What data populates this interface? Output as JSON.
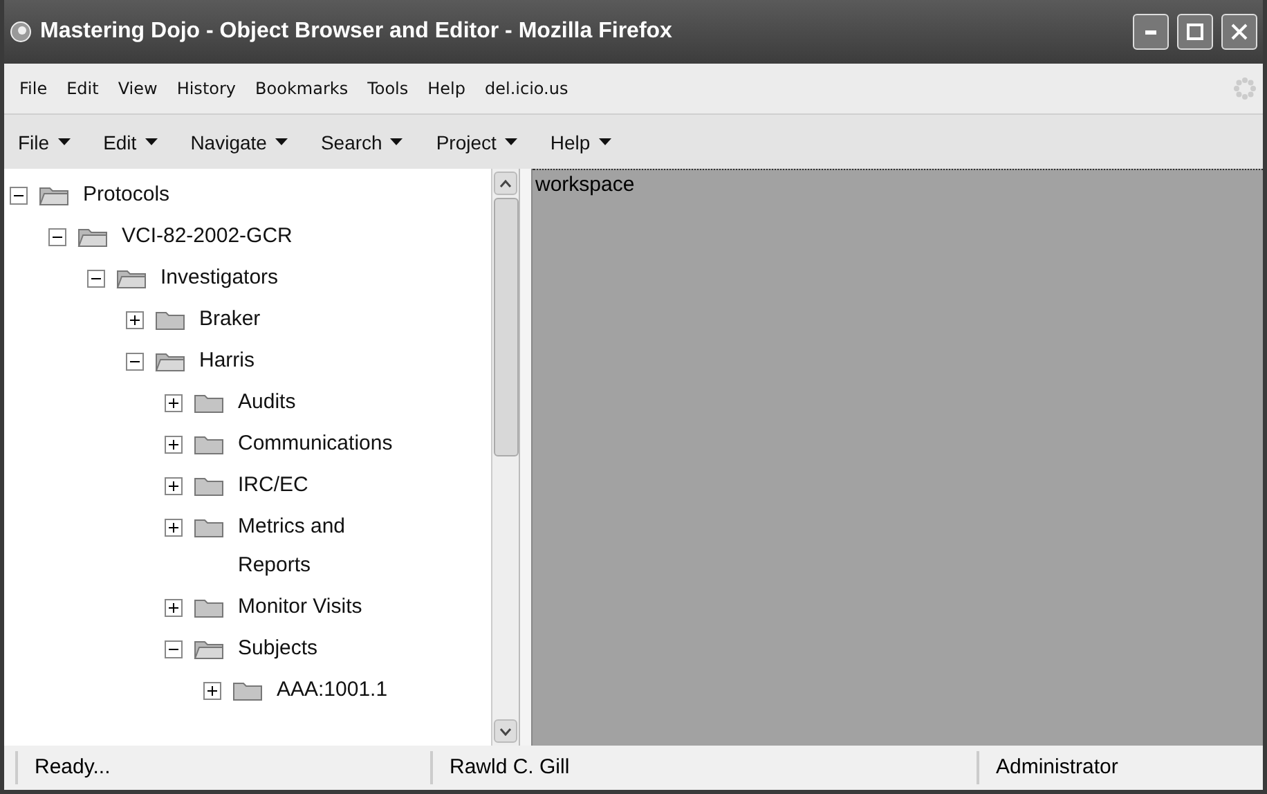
{
  "window": {
    "title": "Mastering Dojo - Object Browser and Editor - Mozilla Firefox"
  },
  "menu_bar": [
    "File",
    "Edit",
    "View",
    "History",
    "Bookmarks",
    "Tools",
    "Help",
    "del.icio.us"
  ],
  "toolbar": [
    "File",
    "Edit",
    "Navigate",
    "Search",
    "Project",
    "Help"
  ],
  "tree": [
    {
      "label": "Protocols",
      "expanded": true,
      "children": [
        {
          "label": "VCI-82-2002-GCR",
          "expanded": true,
          "children": [
            {
              "label": "Investigators",
              "expanded": true,
              "children": [
                {
                  "label": "Braker",
                  "expanded": false
                },
                {
                  "label": "Harris",
                  "expanded": true,
                  "children": [
                    {
                      "label": "Audits",
                      "expanded": false
                    },
                    {
                      "label": "Communications",
                      "expanded": false
                    },
                    {
                      "label": "IRC/EC",
                      "expanded": false
                    },
                    {
                      "label": "Metrics and Reports",
                      "expanded": false
                    },
                    {
                      "label": "Monitor Visits",
                      "expanded": false
                    },
                    {
                      "label": "Subjects",
                      "expanded": true,
                      "children": [
                        {
                          "label": "AAA:1001.1",
                          "expanded": false
                        }
                      ]
                    }
                  ]
                }
              ]
            }
          ]
        }
      ]
    }
  ],
  "workspace": {
    "label": "workspace"
  },
  "status_bar": [
    "Ready...",
    "Rawld C. Gill",
    "Administrator"
  ]
}
